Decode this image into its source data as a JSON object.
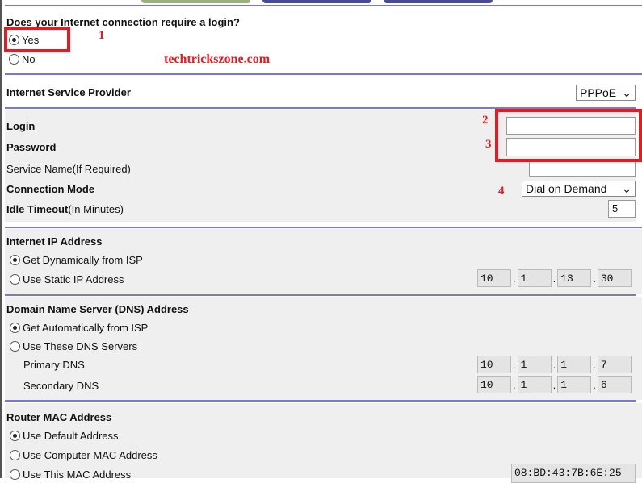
{
  "login_question": {
    "label": "Does your Internet connection require a login?",
    "options": [
      "Yes",
      "No"
    ],
    "selected": "Yes"
  },
  "watermark": "techtrickszone.com",
  "annotations": [
    "1",
    "2",
    "3",
    "4"
  ],
  "isp": {
    "label": "Internet Service Provider",
    "value": "PPPoE"
  },
  "pppoe": {
    "login_label": "Login",
    "login_value": "",
    "password_label": "Password",
    "password_value": "",
    "service_label": "Service Name(If Required)",
    "service_value": "",
    "mode_label": "Connection Mode",
    "mode_value": "Dial on Demand",
    "idle_label_bold": "Idle Timeout",
    "idle_label_rest": "(In Minutes)",
    "idle_value": "5"
  },
  "internet_ip": {
    "title": "Internet IP Address",
    "options": [
      "Get Dynamically from ISP",
      "Use Static IP Address"
    ],
    "selected": 0,
    "ip": [
      "10",
      "1",
      "13",
      "30"
    ]
  },
  "dns": {
    "title": "Domain Name Server (DNS) Address",
    "options": [
      "Get Automatically from ISP",
      "Use These DNS Servers"
    ],
    "selected": 0,
    "primary_label": "Primary DNS",
    "primary": [
      "10",
      "1",
      "1",
      "7"
    ],
    "secondary_label": "Secondary DNS",
    "secondary": [
      "10",
      "1",
      "1",
      "6"
    ]
  },
  "mac": {
    "title": "Router MAC Address",
    "options": [
      "Use Default Address",
      "Use Computer MAC Address",
      "Use This MAC Address"
    ],
    "selected": 0,
    "value": "08:BD:43:7B:6E:25"
  },
  "colors": {
    "rule": "#7777dd",
    "annotation": "#e31b23",
    "section_bg": "#efefef"
  }
}
